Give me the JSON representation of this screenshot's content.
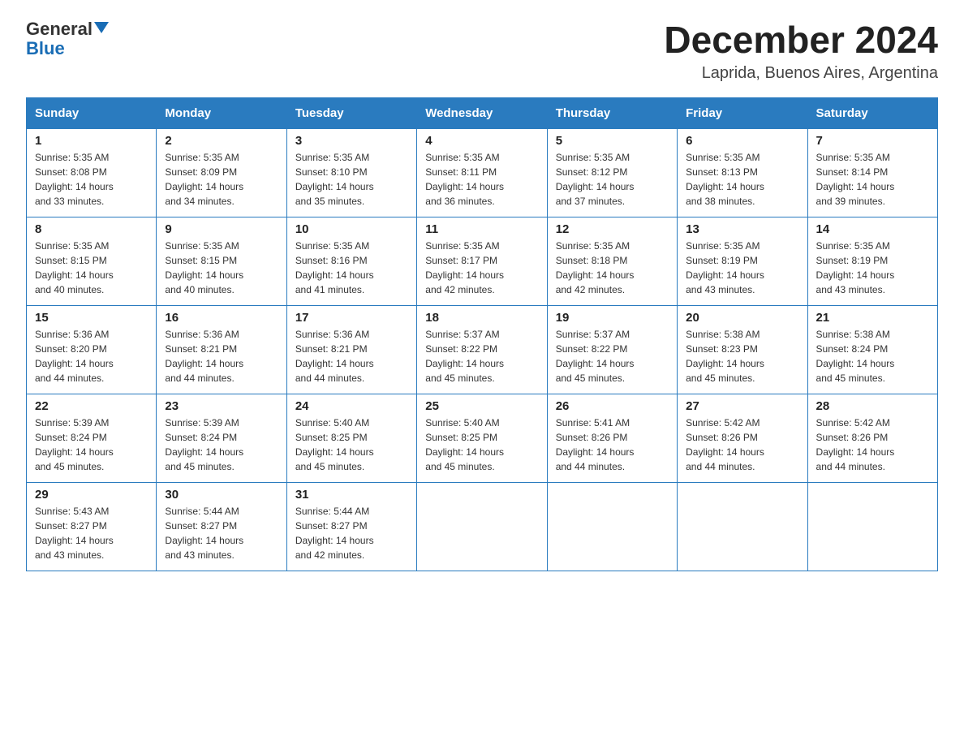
{
  "header": {
    "logo_general": "General",
    "logo_blue": "Blue",
    "month_title": "December 2024",
    "location": "Laprida, Buenos Aires, Argentina"
  },
  "days_of_week": [
    "Sunday",
    "Monday",
    "Tuesday",
    "Wednesday",
    "Thursday",
    "Friday",
    "Saturday"
  ],
  "weeks": [
    [
      {
        "day": "1",
        "sunrise": "5:35 AM",
        "sunset": "8:08 PM",
        "daylight": "14 hours and 33 minutes."
      },
      {
        "day": "2",
        "sunrise": "5:35 AM",
        "sunset": "8:09 PM",
        "daylight": "14 hours and 34 minutes."
      },
      {
        "day": "3",
        "sunrise": "5:35 AM",
        "sunset": "8:10 PM",
        "daylight": "14 hours and 35 minutes."
      },
      {
        "day": "4",
        "sunrise": "5:35 AM",
        "sunset": "8:11 PM",
        "daylight": "14 hours and 36 minutes."
      },
      {
        "day": "5",
        "sunrise": "5:35 AM",
        "sunset": "8:12 PM",
        "daylight": "14 hours and 37 minutes."
      },
      {
        "day": "6",
        "sunrise": "5:35 AM",
        "sunset": "8:13 PM",
        "daylight": "14 hours and 38 minutes."
      },
      {
        "day": "7",
        "sunrise": "5:35 AM",
        "sunset": "8:14 PM",
        "daylight": "14 hours and 39 minutes."
      }
    ],
    [
      {
        "day": "8",
        "sunrise": "5:35 AM",
        "sunset": "8:15 PM",
        "daylight": "14 hours and 40 minutes."
      },
      {
        "day": "9",
        "sunrise": "5:35 AM",
        "sunset": "8:15 PM",
        "daylight": "14 hours and 40 minutes."
      },
      {
        "day": "10",
        "sunrise": "5:35 AM",
        "sunset": "8:16 PM",
        "daylight": "14 hours and 41 minutes."
      },
      {
        "day": "11",
        "sunrise": "5:35 AM",
        "sunset": "8:17 PM",
        "daylight": "14 hours and 42 minutes."
      },
      {
        "day": "12",
        "sunrise": "5:35 AM",
        "sunset": "8:18 PM",
        "daylight": "14 hours and 42 minutes."
      },
      {
        "day": "13",
        "sunrise": "5:35 AM",
        "sunset": "8:19 PM",
        "daylight": "14 hours and 43 minutes."
      },
      {
        "day": "14",
        "sunrise": "5:35 AM",
        "sunset": "8:19 PM",
        "daylight": "14 hours and 43 minutes."
      }
    ],
    [
      {
        "day": "15",
        "sunrise": "5:36 AM",
        "sunset": "8:20 PM",
        "daylight": "14 hours and 44 minutes."
      },
      {
        "day": "16",
        "sunrise": "5:36 AM",
        "sunset": "8:21 PM",
        "daylight": "14 hours and 44 minutes."
      },
      {
        "day": "17",
        "sunrise": "5:36 AM",
        "sunset": "8:21 PM",
        "daylight": "14 hours and 44 minutes."
      },
      {
        "day": "18",
        "sunrise": "5:37 AM",
        "sunset": "8:22 PM",
        "daylight": "14 hours and 45 minutes."
      },
      {
        "day": "19",
        "sunrise": "5:37 AM",
        "sunset": "8:22 PM",
        "daylight": "14 hours and 45 minutes."
      },
      {
        "day": "20",
        "sunrise": "5:38 AM",
        "sunset": "8:23 PM",
        "daylight": "14 hours and 45 minutes."
      },
      {
        "day": "21",
        "sunrise": "5:38 AM",
        "sunset": "8:24 PM",
        "daylight": "14 hours and 45 minutes."
      }
    ],
    [
      {
        "day": "22",
        "sunrise": "5:39 AM",
        "sunset": "8:24 PM",
        "daylight": "14 hours and 45 minutes."
      },
      {
        "day": "23",
        "sunrise": "5:39 AM",
        "sunset": "8:24 PM",
        "daylight": "14 hours and 45 minutes."
      },
      {
        "day": "24",
        "sunrise": "5:40 AM",
        "sunset": "8:25 PM",
        "daylight": "14 hours and 45 minutes."
      },
      {
        "day": "25",
        "sunrise": "5:40 AM",
        "sunset": "8:25 PM",
        "daylight": "14 hours and 45 minutes."
      },
      {
        "day": "26",
        "sunrise": "5:41 AM",
        "sunset": "8:26 PM",
        "daylight": "14 hours and 44 minutes."
      },
      {
        "day": "27",
        "sunrise": "5:42 AM",
        "sunset": "8:26 PM",
        "daylight": "14 hours and 44 minutes."
      },
      {
        "day": "28",
        "sunrise": "5:42 AM",
        "sunset": "8:26 PM",
        "daylight": "14 hours and 44 minutes."
      }
    ],
    [
      {
        "day": "29",
        "sunrise": "5:43 AM",
        "sunset": "8:27 PM",
        "daylight": "14 hours and 43 minutes."
      },
      {
        "day": "30",
        "sunrise": "5:44 AM",
        "sunset": "8:27 PM",
        "daylight": "14 hours and 43 minutes."
      },
      {
        "day": "31",
        "sunrise": "5:44 AM",
        "sunset": "8:27 PM",
        "daylight": "14 hours and 42 minutes."
      },
      null,
      null,
      null,
      null
    ]
  ],
  "labels": {
    "sunrise": "Sunrise:",
    "sunset": "Sunset:",
    "daylight": "Daylight:"
  }
}
